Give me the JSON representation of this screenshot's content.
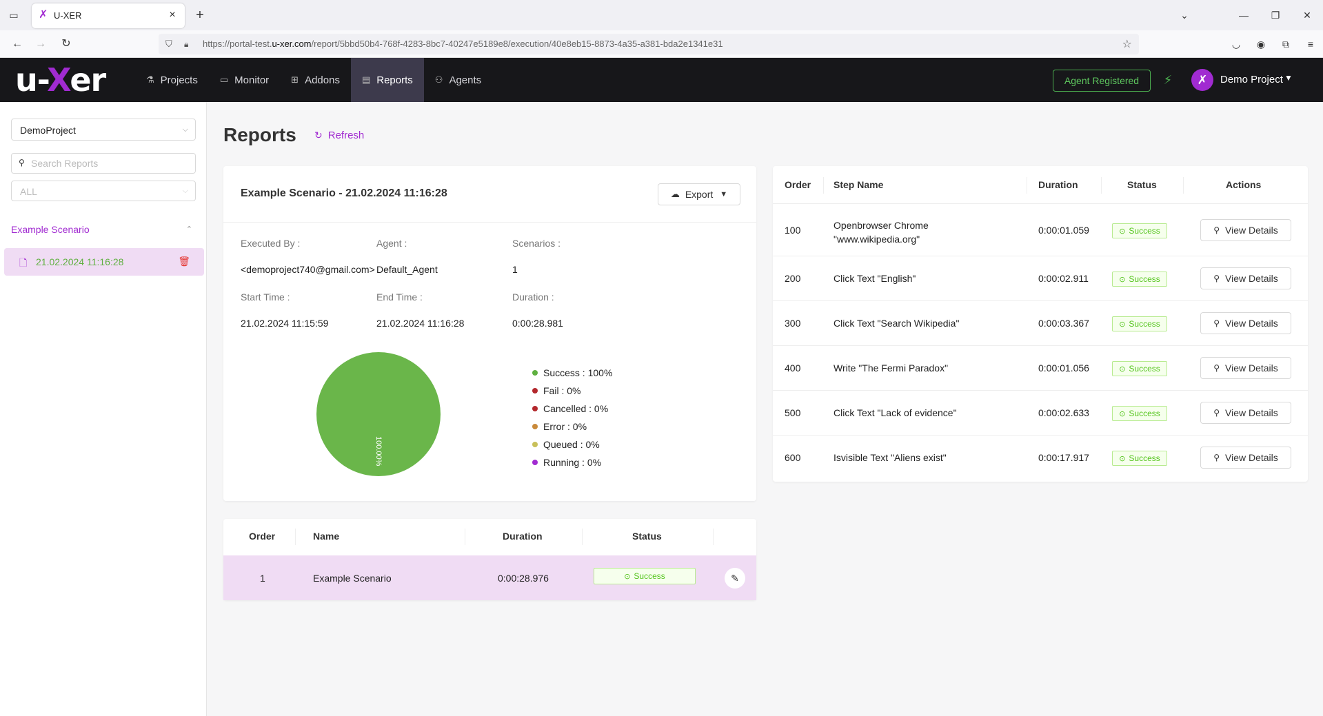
{
  "browser": {
    "tab_title": "U-XER",
    "url_prefix": "https://portal-test.",
    "url_domain": "u-xer.com",
    "url_path": "/report/5bbd50b4-768f-4283-8bc7-40247e5189e8/execution/40e8eb15-8873-4a35-a381-bda2e1341e31"
  },
  "header": {
    "logo_left": "u-",
    "logo_x": "X",
    "logo_right": "er",
    "menu": [
      {
        "label": "Projects",
        "icon": "flask-icon"
      },
      {
        "label": "Monitor",
        "icon": "monitor-icon"
      },
      {
        "label": "Addons",
        "icon": "grid-icon"
      },
      {
        "label": "Reports",
        "icon": "document-icon"
      },
      {
        "label": "Agents",
        "icon": "agents-icon"
      }
    ],
    "active_menu": "Reports",
    "agent_status": "Agent Registered",
    "project_name": "Demo Project",
    "accent_color": "#a12bd1",
    "success_color": "#4caf50"
  },
  "sidebar": {
    "project_select": "DemoProject",
    "search_placeholder": "Search Reports",
    "filter_select": "ALL",
    "group_label": "Example Scenario",
    "report_item": "21.02.2024 11:16:28"
  },
  "main": {
    "title": "Reports",
    "refresh_label": "Refresh"
  },
  "summary": {
    "title": "Example Scenario - 21.02.2024 11:16:28",
    "export_label": "Export",
    "executed_by_label": "Executed By",
    "executed_by": "<demoproject740@gmail.com>",
    "agent_label": "Agent",
    "agent": "Default_Agent",
    "scenarios_label": "Scenarios",
    "scenarios": "1",
    "start_time_label": "Start Time",
    "start_time": "21.02.2024 11:15:59",
    "end_time_label": "End Time",
    "end_time": "21.02.2024 11:16:28",
    "duration_label": "Duration",
    "duration": "0:00:28.981",
    "legend": [
      {
        "label": "Success : 100%",
        "color": "#5fb040"
      },
      {
        "label": "Fail : 0%",
        "color": "#b3282d"
      },
      {
        "label": "Cancelled : 0%",
        "color": "#b3282d"
      },
      {
        "label": "Error : 0%",
        "color": "#c98a3b"
      },
      {
        "label": "Queued : 0%",
        "color": "#c8c05a"
      },
      {
        "label": "Running : 0%",
        "color": "#a12bd1"
      }
    ]
  },
  "chart_data": {
    "type": "pie",
    "categories": [
      "Success",
      "Fail",
      "Cancelled",
      "Error",
      "Queued",
      "Running"
    ],
    "values": [
      100,
      0,
      0,
      0,
      0,
      0
    ],
    "colors": [
      "#6ab64a",
      "#b3282d",
      "#b3282d",
      "#c98a3b",
      "#c8c05a",
      "#a12bd1"
    ],
    "slice_label": "100.00%",
    "legend_position": "right"
  },
  "scenario_table": {
    "headers": {
      "order": "Order",
      "name": "Name",
      "duration": "Duration",
      "status": "Status"
    },
    "row": {
      "order": "1",
      "name": "Example Scenario",
      "duration": "0:00:28.976",
      "status": "Success"
    }
  },
  "steps_table": {
    "headers": {
      "order": "Order",
      "step_name": "Step Name",
      "duration": "Duration",
      "status": "Status",
      "actions": "Actions"
    },
    "view_label": "View Details",
    "rows": [
      {
        "order": "100",
        "name_line1": "Openbrowser Chrome",
        "name_line2": "\"www.wikipedia.org\"",
        "duration": "0:00:01.059",
        "status": "Success"
      },
      {
        "order": "200",
        "name_line1": "Click Text \"English\"",
        "name_line2": "",
        "duration": "0:00:02.911",
        "status": "Success"
      },
      {
        "order": "300",
        "name_line1": "Click Text \"Search Wikipedia\"",
        "name_line2": "",
        "duration": "0:00:03.367",
        "status": "Success"
      },
      {
        "order": "400",
        "name_line1": "Write \"The Fermi Paradox\"",
        "name_line2": "",
        "duration": "0:00:01.056",
        "status": "Success"
      },
      {
        "order": "500",
        "name_line1": "Click Text \"Lack of evidence\"",
        "name_line2": "",
        "duration": "0:00:02.633",
        "status": "Success"
      },
      {
        "order": "600",
        "name_line1": "Isvisible Text \"Aliens exist\"",
        "name_line2": "",
        "duration": "0:00:17.917",
        "status": "Success"
      }
    ]
  }
}
